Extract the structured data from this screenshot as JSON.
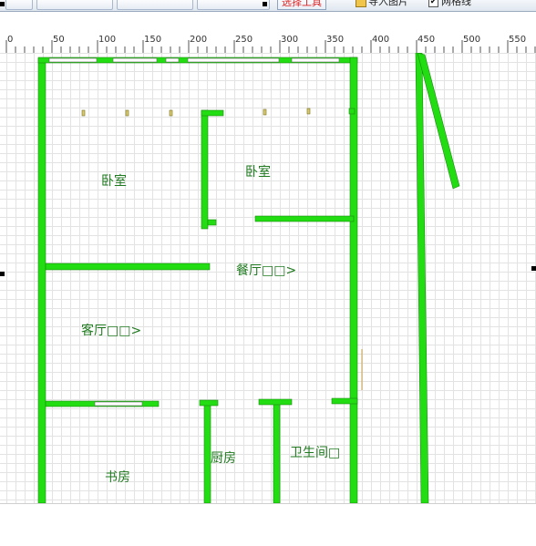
{
  "toolbar": {
    "button_label": "选择工具",
    "import_image": "导入图片",
    "grid_label": "网格线",
    "grid_checked": "✔"
  },
  "ruler": {
    "ticks": [
      "0",
      "50",
      "100",
      "150",
      "200",
      "250",
      "300",
      "350",
      "400",
      "450",
      "500",
      "550"
    ]
  },
  "floorplan": {
    "wall_color": "#22dd11",
    "label_color": "#1f7a1f",
    "rooms": [
      {
        "id": "bedroom-1",
        "label": "卧室"
      },
      {
        "id": "bedroom-2",
        "label": "卧室"
      },
      {
        "id": "dining",
        "label": "餐厅□□>"
      },
      {
        "id": "living",
        "label": "客厅□□>"
      },
      {
        "id": "study",
        "label": "书房"
      },
      {
        "id": "kitchen",
        "label": "厨房"
      },
      {
        "id": "bathroom",
        "label": "卫生间□"
      }
    ]
  }
}
